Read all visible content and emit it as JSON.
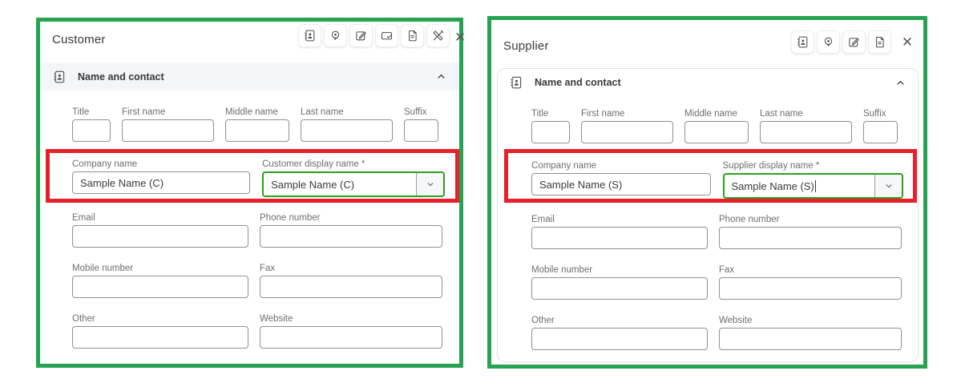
{
  "colors": {
    "annotation_green": "#25a351",
    "annotation_red": "#e8202b",
    "focus_green": "#2ba01d"
  },
  "customer": {
    "title": "Customer",
    "close_icon": "✕",
    "toolbar": [
      {
        "name": "contact-book"
      },
      {
        "name": "location-pin"
      },
      {
        "name": "edit-note"
      },
      {
        "name": "payment-card"
      },
      {
        "name": "document"
      },
      {
        "name": "design-tools"
      }
    ],
    "section": {
      "title": "Name and contact"
    },
    "fields": {
      "title": {
        "label": "Title",
        "value": ""
      },
      "first_name": {
        "label": "First name",
        "value": ""
      },
      "middle_name": {
        "label": "Middle name",
        "value": ""
      },
      "last_name": {
        "label": "Last name",
        "value": ""
      },
      "suffix": {
        "label": "Suffix",
        "value": ""
      },
      "company_name": {
        "label": "Company name",
        "value": "Sample Name (C)"
      },
      "display_name": {
        "label": "Customer display name *",
        "value": "Sample Name (C)"
      },
      "email": {
        "label": "Email",
        "value": ""
      },
      "phone": {
        "label": "Phone number",
        "value": ""
      },
      "mobile": {
        "label": "Mobile number",
        "value": ""
      },
      "fax": {
        "label": "Fax",
        "value": ""
      },
      "other": {
        "label": "Other",
        "value": ""
      },
      "website": {
        "label": "Website",
        "value": ""
      }
    }
  },
  "supplier": {
    "title": "Supplier",
    "close_icon": "✕",
    "toolbar": [
      {
        "name": "contact-book"
      },
      {
        "name": "location-pin"
      },
      {
        "name": "edit-note"
      },
      {
        "name": "document"
      }
    ],
    "section": {
      "title": "Name and contact"
    },
    "fields": {
      "title": {
        "label": "Title",
        "value": ""
      },
      "first_name": {
        "label": "First name",
        "value": ""
      },
      "middle_name": {
        "label": "Middle name",
        "value": ""
      },
      "last_name": {
        "label": "Last name",
        "value": ""
      },
      "suffix": {
        "label": "Suffix",
        "value": ""
      },
      "company_name": {
        "label": "Company name",
        "value": "Sample Name (S)"
      },
      "display_name": {
        "label": "Supplier display name *",
        "value": "Sample Name (S)"
      },
      "email": {
        "label": "Email",
        "value": ""
      },
      "phone": {
        "label": "Phone number",
        "value": ""
      },
      "mobile": {
        "label": "Mobile number",
        "value": ""
      },
      "fax": {
        "label": "Fax",
        "value": ""
      },
      "other": {
        "label": "Other",
        "value": ""
      },
      "website": {
        "label": "Website",
        "value": ""
      }
    }
  }
}
